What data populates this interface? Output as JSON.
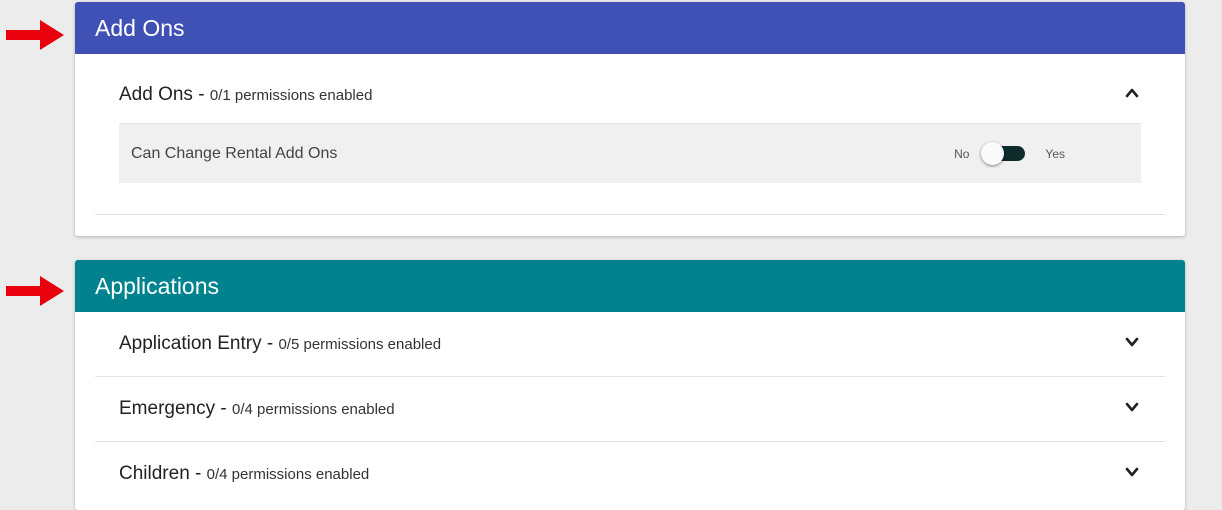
{
  "colors": {
    "addons_header": "#3f51b5",
    "applications_header": "#00838f",
    "arrow": "#e8000c"
  },
  "addons_section": {
    "title": "Add Ons",
    "groups": [
      {
        "name": "Add Ons",
        "separator": " - ",
        "count": "0/1 permissions enabled",
        "expanded": true,
        "permissions": [
          {
            "label": "Can Change Rental Add Ons",
            "off_label": "No",
            "on_label": "Yes",
            "enabled": false
          }
        ]
      }
    ]
  },
  "applications_section": {
    "title": "Applications",
    "groups": [
      {
        "name": "Application Entry",
        "separator": " - ",
        "count": "0/5 permissions enabled",
        "expanded": false
      },
      {
        "name": "Emergency",
        "separator": " - ",
        "count": "0/4 permissions enabled",
        "expanded": false
      },
      {
        "name": "Children",
        "separator": " - ",
        "count": "0/4 permissions enabled",
        "expanded": false
      }
    ]
  }
}
